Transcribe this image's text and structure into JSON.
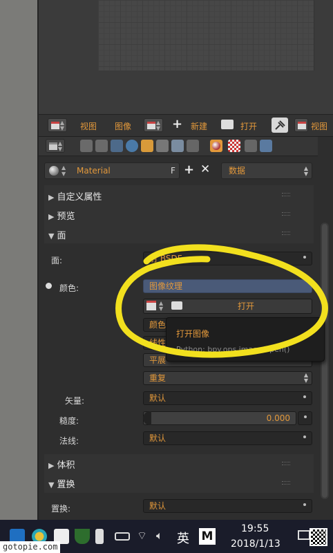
{
  "header": {
    "view_label": "视图",
    "image_label": "图像",
    "new_label": "新建",
    "open_label": "打开",
    "view2_label": "视图"
  },
  "material": {
    "name": "Material",
    "fake_user": "F",
    "data_label": "数据"
  },
  "panels": {
    "custom_props": "自定义属性",
    "preview": "预览",
    "surface": "面",
    "volume": "体积",
    "displacement": "置换"
  },
  "surface": {
    "surface_label": "面:",
    "surface_value": "射 BSDF",
    "color_label": "颜色:",
    "color_value": "图像纹理",
    "open_button": "打开",
    "color_sub": "颜色",
    "color_sub2": "线性",
    "projection_value": "平展",
    "extension_value": "重复",
    "vector_label": "矢量:",
    "vector_value": "默认",
    "roughness_label": "糙度:",
    "roughness_value": "0.000",
    "normal_label": "法线:",
    "normal_value": "默认"
  },
  "displacement": {
    "label": "置换:",
    "value": "默认"
  },
  "tooltip": {
    "title": "打开图像",
    "python": "Python: bpy.ops.image.open()"
  },
  "taskbar": {
    "ime": "英",
    "time": "19:55",
    "date": "2018/1/13"
  },
  "watermark": "gotopie.com",
  "colors": {
    "accent": "#e2983b",
    "highlight": "#4a5a78",
    "annotation": "#f2e01e"
  }
}
